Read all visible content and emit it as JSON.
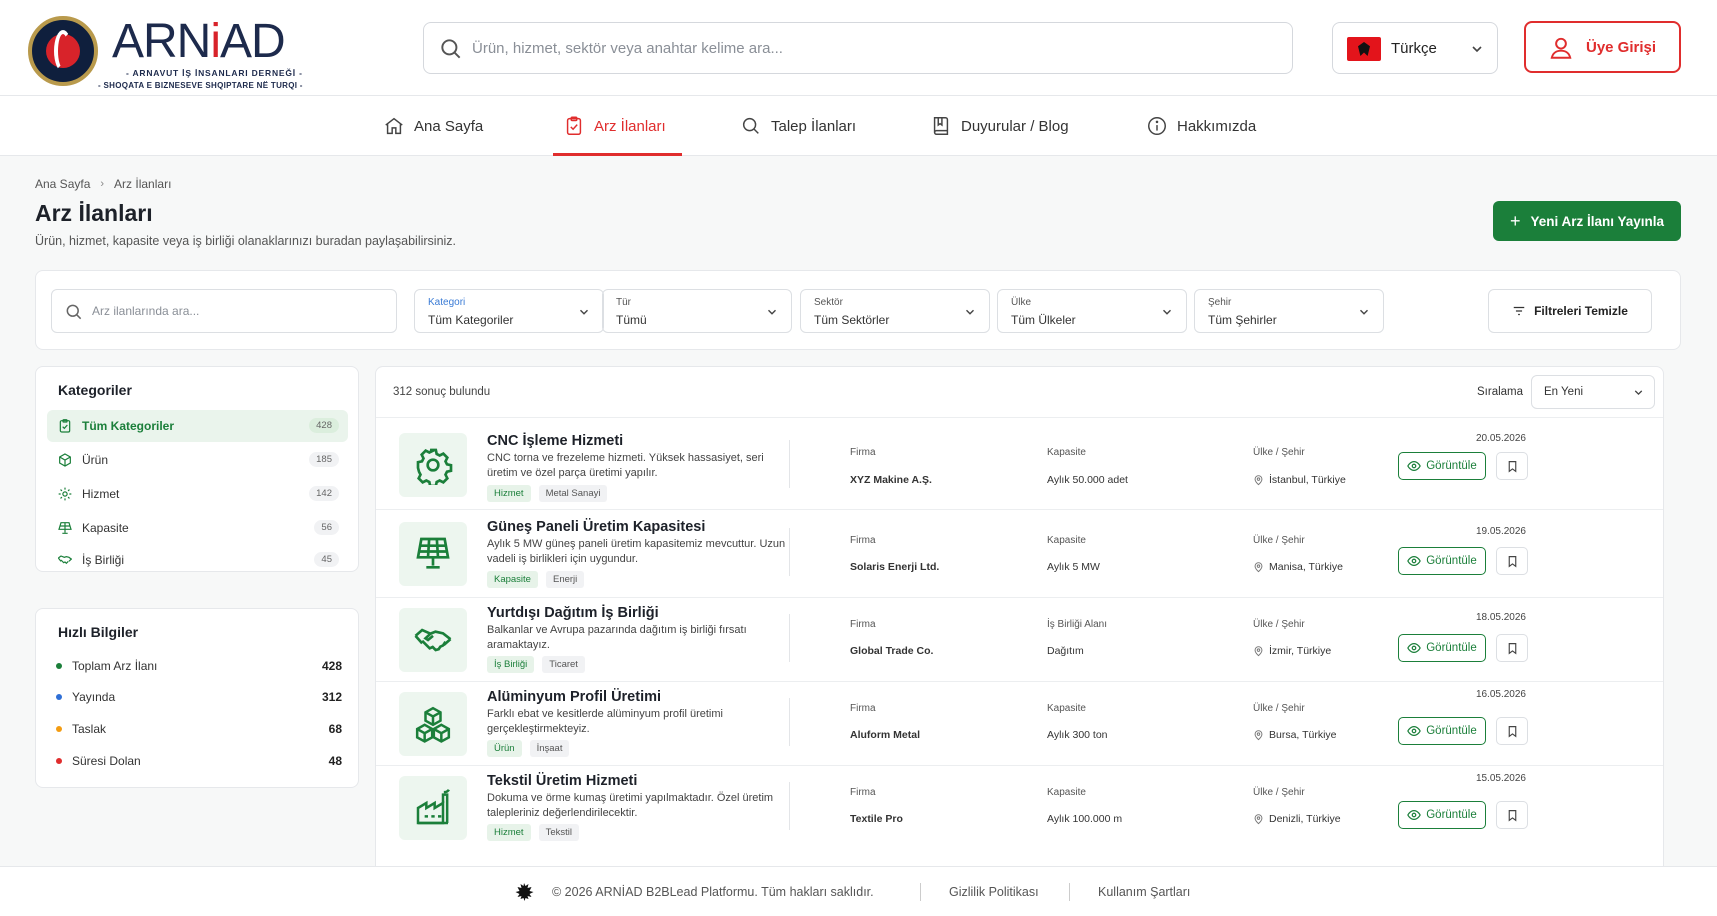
{
  "brand": {
    "name_start": "ARN",
    "name_i": "i",
    "name_end": "AD",
    "subtitle_tr": "- ARNAVUT İŞ İNSANLARI DERNEĞİ -",
    "subtitle_sq": "- SHOQATA E BIZNESEVE SHQIPTARE NË TURQI -"
  },
  "header": {
    "search_placeholder": "Ürün, hizmet, sektör veya anahtar kelime ara...",
    "language": "Türkçe",
    "login_label": "Üye Girişi"
  },
  "nav": [
    {
      "label": "Ana Sayfa",
      "icon": "home-icon"
    },
    {
      "label": "Arz İlanları",
      "icon": "clipboard-icon",
      "active": true
    },
    {
      "label": "Talep İlanları",
      "icon": "search-icon"
    },
    {
      "label": "Duyurular / Blog",
      "icon": "book-icon"
    },
    {
      "label": "Hakkımızda",
      "icon": "info-icon"
    }
  ],
  "breadcrumb": [
    "Ana Sayfa",
    "Arz İlanları"
  ],
  "page": {
    "title": "Arz İlanları",
    "subtitle": "Ürün, hizmet, kapasite veya iş birliği olanaklarınızı buradan paylaşabilirsiniz.",
    "new_button": "Yeni Arz İlanı Yayınla"
  },
  "filters": {
    "search_placeholder": "Arz ilanlarında ara...",
    "selects": [
      {
        "label": "Kategori",
        "value": "Tüm Kategoriler"
      },
      {
        "label": "Tür",
        "value": "Tümü"
      },
      {
        "label": "Sektör",
        "value": "Tüm Sektörler"
      },
      {
        "label": "Ülke",
        "value": "Tüm Ülkeler"
      },
      {
        "label": "Şehir",
        "value": "Tüm Şehirler"
      }
    ],
    "clear_label": "Filtreleri Temizle"
  },
  "categories": {
    "heading": "Kategoriler",
    "items": [
      {
        "label": "Tüm Kategoriler",
        "count": "428",
        "active": true
      },
      {
        "label": "Ürün",
        "count": "185"
      },
      {
        "label": "Hizmet",
        "count": "142"
      },
      {
        "label": "Kapasite",
        "count": "56"
      },
      {
        "label": "İş Birliği",
        "count": "45"
      }
    ]
  },
  "quick_info": {
    "heading": "Hızlı Bilgiler",
    "items": [
      {
        "label": "Toplam Arz İlanı",
        "value": "428",
        "color": "#1b7f3a"
      },
      {
        "label": "Yayında",
        "value": "312",
        "color": "#2f6fd6"
      },
      {
        "label": "Taslak",
        "value": "68",
        "color": "#f39c12"
      },
      {
        "label": "Süresi Dolan",
        "value": "48",
        "color": "#e02d2d"
      }
    ]
  },
  "results": {
    "count_text": "312 sonuç bulundu",
    "sort_label": "Sıralama",
    "sort_value": "En Yeni",
    "view_label": "Görüntüle",
    "location_label": "Ülke / Şehir",
    "company_label": "Firma",
    "listings": [
      {
        "title": "CNC İşleme Hizmeti",
        "desc": "CNC torna ve frezeleme hizmeti. Yüksek hassasiyet, seri üretim ve özel parça üretimi yapılır.",
        "tags": [
          "Hizmet",
          "Metal Sanayi"
        ],
        "company": "XYZ Makine A.Ş.",
        "metric_label": "Kapasite",
        "metric_value": "Aylık 50.000 adet",
        "location": "İstanbul, Türkiye",
        "date": "20.05.2026",
        "icon": "gear-icon"
      },
      {
        "title": "Güneş Paneli Üretim Kapasitesi",
        "desc": "Aylık 5 MW güneş paneli üretim kapasitemiz mevcuttur. Uzun vadeli iş birlikleri için uygundur.",
        "tags": [
          "Kapasite",
          "Enerji"
        ],
        "company": "Solaris Enerji Ltd.",
        "metric_label": "Kapasite",
        "metric_value": "Aylık 5 MW",
        "location": "Manisa, Türkiye",
        "date": "19.05.2026",
        "icon": "solar-panel-icon"
      },
      {
        "title": "Yurtdışı Dağıtım İş Birliği",
        "desc": "Balkanlar ve Avrupa pazarında dağıtım iş birliği fırsatı aramaktayız.",
        "tags": [
          "İş Birliği",
          "Ticaret"
        ],
        "company": "Global Trade Co.",
        "metric_label": "İş Birliği Alanı",
        "metric_value": "Dağıtım",
        "location": "İzmir, Türkiye",
        "date": "18.05.2026",
        "icon": "handshake-icon"
      },
      {
        "title": "Alüminyum Profil Üretimi",
        "desc": "Farklı ebat ve kesitlerde alüminyum profil üretimi gerçekleştirmekteyiz.",
        "tags": [
          "Ürün",
          "İnşaat"
        ],
        "company": "Aluform Metal",
        "metric_label": "Kapasite",
        "metric_value": "Aylık 300 ton",
        "location": "Bursa, Türkiye",
        "date": "16.05.2026",
        "icon": "boxes-icon"
      },
      {
        "title": "Tekstil Üretim Hizmeti",
        "desc": "Dokuma ve örme kumaş üretimi yapılmaktadır. Özel üretim talepleriniz değerlendirilecektir.",
        "tags": [
          "Hizmet",
          "Tekstil"
        ],
        "company": "Textile Pro",
        "metric_label": "Kapasite",
        "metric_value": "Aylık 100.000 m",
        "location": "Denizli, Türkiye",
        "date": "15.05.2026",
        "icon": "factory-icon"
      }
    ]
  },
  "footer": {
    "copyright": "©  2026 ARNİAD B2BLead Platformu. Tüm hakları saklıdır.",
    "privacy": "Gizlilik Politikası",
    "terms": "Kullanım Şartları"
  }
}
